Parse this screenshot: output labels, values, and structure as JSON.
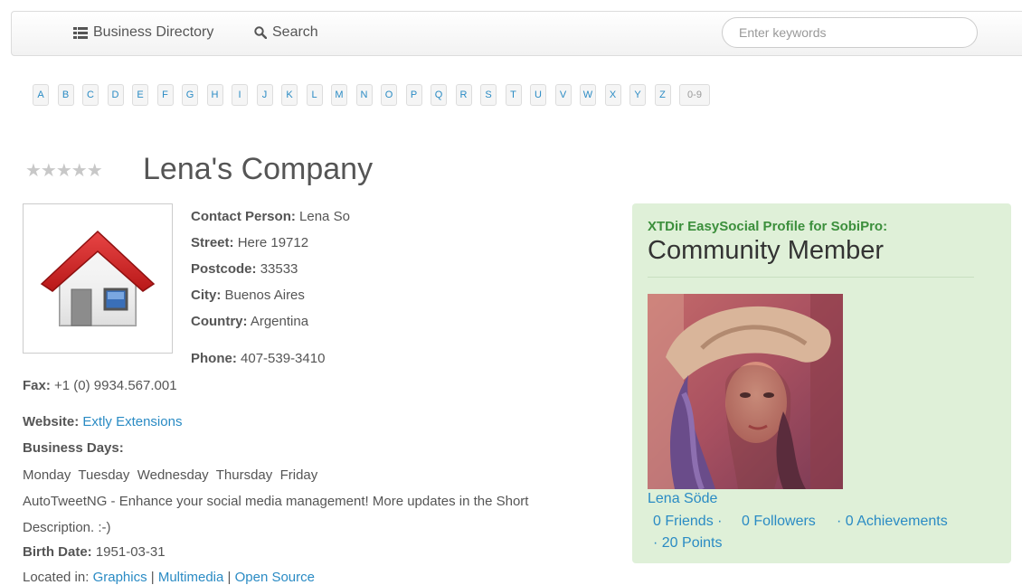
{
  "nav": {
    "directory_label": "Business Directory",
    "search_label": "Search",
    "keywords_placeholder": "Enter keywords"
  },
  "letters": [
    "A",
    "B",
    "C",
    "D",
    "E",
    "F",
    "G",
    "H",
    "I",
    "J",
    "K",
    "L",
    "M",
    "N",
    "O",
    "P",
    "Q",
    "R",
    "S",
    "T",
    "U",
    "V",
    "W",
    "X",
    "Y",
    "Z"
  ],
  "letter_numeric": "0-9",
  "entry": {
    "stars": "★★★★★",
    "rating": 0,
    "title": "Lena's Company",
    "contact_label": "Contact Person:",
    "contact_value": "Lena So",
    "street_label": "Street:",
    "street_value": "Here 19712",
    "postcode_label": "Postcode:",
    "postcode_value": "33533",
    "city_label": "City:",
    "city_value": "Buenos Aires",
    "country_label": "Country:",
    "country_value": "Argentina",
    "phone_label": "Phone:",
    "phone_value": "407-539-3410",
    "fax_label": "Fax:",
    "fax_value": "+1 (0) 9934.567.001",
    "website_label": "Website:",
    "website_value": "Extly Extensions",
    "days_label": "Business Days:",
    "days_value": "Monday  Tuesday  Wednesday  Thursday  Friday",
    "desc_line1": "AutoTweetNG - Enhance your social media management! More updates in the Short",
    "desc_line2": "Description. :-)",
    "birth_label": "Birth Date:",
    "birth_value": "1951-03-31",
    "located_label": "Located in:",
    "categories": [
      "Graphics",
      "Multimedia",
      "Open Source"
    ],
    "category_sep": " | "
  },
  "profile": {
    "subtitle": "XTDir EasySocial Profile for SobiPro:",
    "title": "Community Member",
    "name": "Lena Söde",
    "friends": "0 Friends ·",
    "followers": "0 Followers",
    "achievements": "· 0 Achievements",
    "points": "· 20 Points"
  },
  "colors": {
    "link": "#2a8bc4",
    "panel_bg": "#dff0d8",
    "panel_subtitle": "#3c8f3c",
    "roof_red": "#d62b2b"
  }
}
